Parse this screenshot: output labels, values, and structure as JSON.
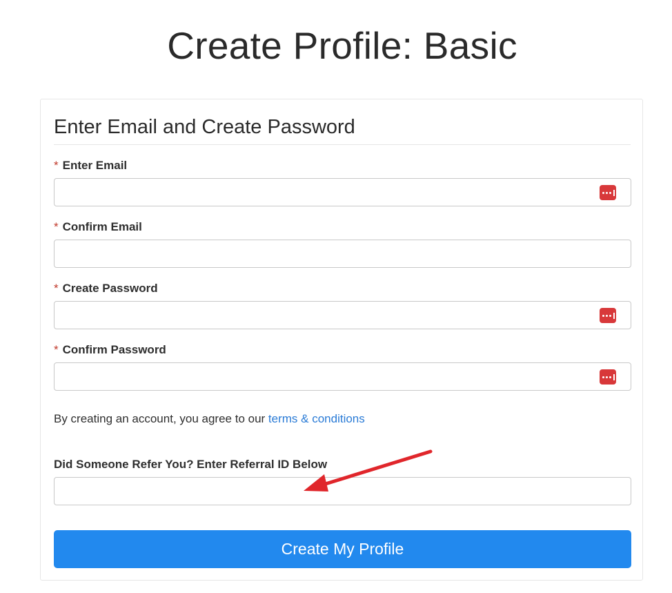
{
  "page": {
    "title": "Create Profile: Basic"
  },
  "form": {
    "heading": "Enter Email and Create Password",
    "required_marker": "*",
    "fields": {
      "email": {
        "label": "Enter Email",
        "value": ""
      },
      "confirm_email": {
        "label": "Confirm Email",
        "value": ""
      },
      "password": {
        "label": "Create Password",
        "value": ""
      },
      "confirm_password": {
        "label": "Confirm Password",
        "value": ""
      },
      "referral": {
        "label": "Did Someone Refer You? Enter Referral ID Below",
        "value": ""
      }
    },
    "terms": {
      "prefix": "By creating an account, you agree to our ",
      "link_text": "terms & conditions"
    },
    "submit_label": "Create My Profile"
  },
  "icons": {
    "password_manager": "password-manager-icon",
    "annotation": "red-arrow"
  },
  "colors": {
    "primary_button": "#2289ee",
    "link": "#2a7bd6",
    "required": "#c0392b",
    "password_manager_badge": "#d8383a",
    "annotation_arrow": "#e0262b"
  }
}
